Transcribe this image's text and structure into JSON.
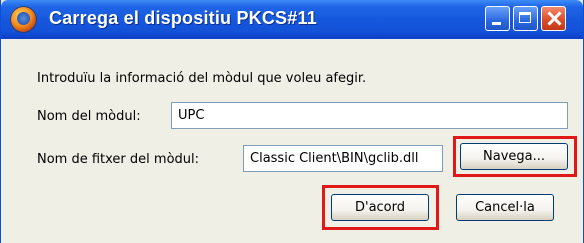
{
  "window": {
    "title": "Carrega el dispositiu PKCS#11"
  },
  "dialog": {
    "instruction": "Introduïu la informació del mòdul que voleu afegir.",
    "module_name_label": "Nom del mòdul:",
    "module_name_value": "UPC",
    "module_file_label": "Nom de fitxer del mòdul:",
    "module_file_value": "Classic Client\\BIN\\gclib.dll",
    "browse_label": "Navega...",
    "ok_label": "D'acord",
    "cancel_label": "Cancel·la"
  },
  "colors": {
    "titlebar": "#1556dc",
    "highlight": "#e01818"
  },
  "icons": {
    "app": "firefox-icon",
    "minimize": "minimize-icon",
    "maximize": "maximize-icon",
    "close": "close-icon"
  }
}
